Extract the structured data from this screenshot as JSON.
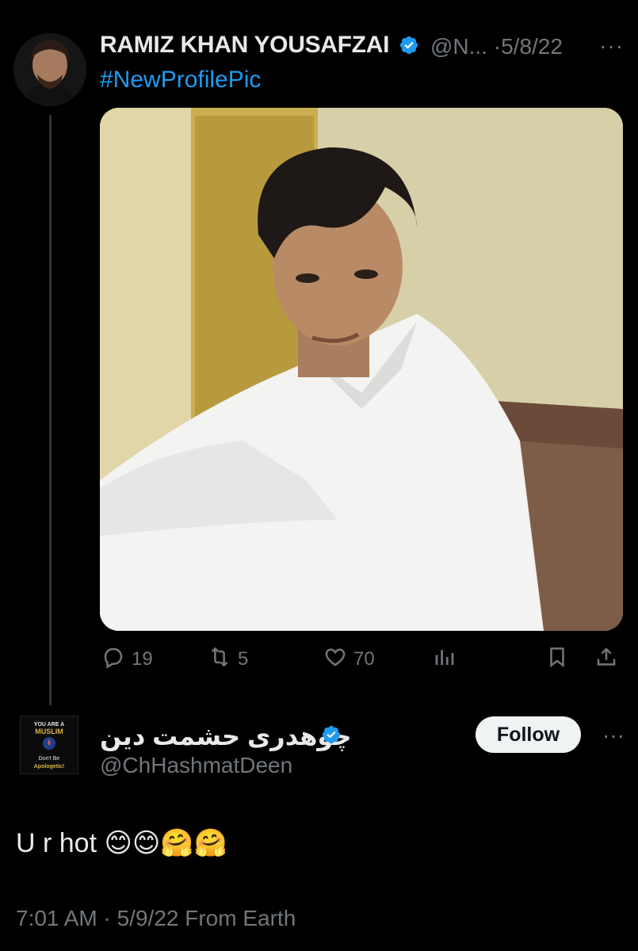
{
  "tweet": {
    "author_name": "RAMIZ KHAN YOUSAFZAI",
    "author_handle": "@N...",
    "date_sep": "·",
    "date": "5/8/22",
    "more": "···",
    "text": "#NewProfilePic",
    "stats": {
      "replies": "19",
      "retweets": "5",
      "likes": "70"
    }
  },
  "reply": {
    "author_name": "چوهدری حشمت دین",
    "author_handle": "@ChHashmatDeen",
    "follow_label": "Follow",
    "more": "···",
    "text": "U r hot 😊😊🤗🤗",
    "timestamp": "7:01 AM · 5/9/22 From Earth",
    "avatar_text": {
      "line1": "YOU ARE A",
      "line2": "MUSLIM",
      "line3": "Don't Be",
      "line4": "Apologetic!"
    }
  },
  "colors": {
    "background": "#000000",
    "link": "#1d9bf0",
    "verified": "#1d9bf0",
    "muted": "#71767b"
  }
}
